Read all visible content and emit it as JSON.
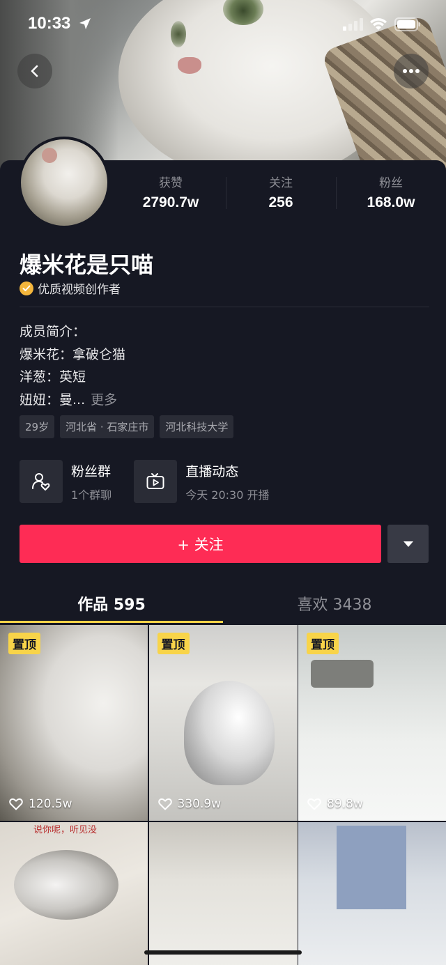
{
  "status_bar": {
    "time": "10:33"
  },
  "profile": {
    "name": "爆米花是只喵",
    "badge": "优质视频创作者",
    "stats": [
      {
        "label": "获赞",
        "value": "2790.7w"
      },
      {
        "label": "关注",
        "value": "256"
      },
      {
        "label": "粉丝",
        "value": "168.0w"
      }
    ],
    "bio": {
      "line1": "成员简介：",
      "line2": "爆米花：拿破仑猫",
      "line3": "洋葱：英短",
      "line4": "妞妞：曼...",
      "more": "更多"
    },
    "tags": [
      "29岁",
      "河北省 · 石家庄市",
      "河北科技大学"
    ]
  },
  "features": [
    {
      "title": "粉丝群",
      "subtitle": "1个群聊",
      "icon": "fan-group-icon"
    },
    {
      "title": "直播动态",
      "subtitle": "今天 20:30 开播",
      "icon": "live-tv-icon"
    }
  ],
  "actions": {
    "follow_label": "+ 关注"
  },
  "tabs": [
    {
      "label": "作品 595",
      "active": true
    },
    {
      "label": "喜欢 3438",
      "active": false
    }
  ],
  "videos": [
    {
      "pinned": true,
      "pin_label": "置顶",
      "likes": "120.5w"
    },
    {
      "pinned": true,
      "pin_label": "置顶",
      "likes": "330.9w"
    },
    {
      "pinned": true,
      "pin_label": "置顶",
      "likes": "89.8w"
    },
    {
      "pinned": false,
      "caption": "说你呢，听见没"
    },
    {
      "pinned": false
    },
    {
      "pinned": false
    }
  ],
  "colors": {
    "background": "#161823",
    "follow_button": "#fe2c55",
    "pin_badge": "#f8d449",
    "verified_badge": "#f4b63c"
  }
}
